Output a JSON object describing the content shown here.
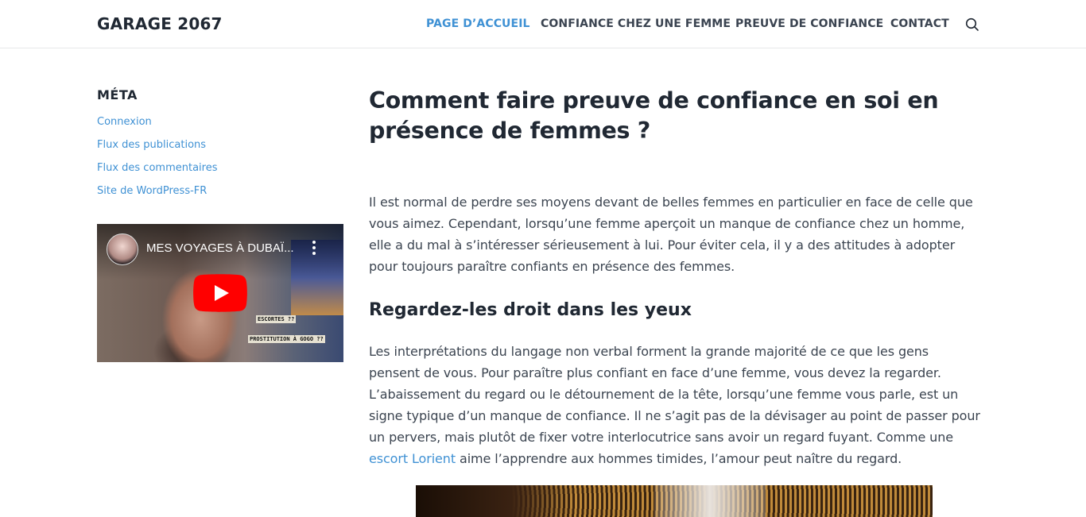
{
  "header": {
    "site_title": "GARAGE 2067",
    "nav": [
      {
        "label": "PAGE D’ACCUEIL",
        "active": true
      },
      {
        "label": "CONFIANCE CHEZ UNE FEMME",
        "active": false
      },
      {
        "label": "PREUVE DE CONFIANCE",
        "active": false
      },
      {
        "label": "CONTACT",
        "active": false
      }
    ],
    "search_icon": "search-icon"
  },
  "sidebar": {
    "meta_title": "MÉTA",
    "meta_links": [
      "Connexion",
      "Flux des publications",
      "Flux des commentaires",
      "Site de WordPress-FR"
    ],
    "video": {
      "title": "MES VOYAGES À DUBAÏ...",
      "tag1": "ESCORTES ??",
      "tag2": "PROSTITUTION À GOGO ??"
    }
  },
  "main": {
    "title": "Comment faire preuve de confiance en soi en présence de femmes ?",
    "intro": "Il est normal de perdre ses moyens devant de belles femmes en particulier en face de celle que vous aimez. Cependant, lorsqu’une femme aperçoit un manque de confiance chez un homme, elle a du mal à s’intéresser sérieusement à lui. Pour éviter cela, il y a des attitudes à adopter pour toujours paraître confiants en présence des femmes.",
    "section_heading": "Regardez-les droit dans les yeux",
    "body_before_link": "Les interprétations du langage non verbal forment la grande majorité de ce que les gens pensent de vous. Pour paraître plus confiant en face d’une femme, vous devez la regarder. L’abaissement du regard ou le détournement de la tête, lorsqu’une femme vous parle, est un signe typique d’un manque de confiance. Il ne s’agit pas de la dévisager au point de passer pour un pervers, mais plutôt de fixer votre interlocutrice sans avoir un regard fuyant. Comme une ",
    "link_text": "escort Lorient",
    "body_after_link": " aime l’apprendre aux hommes timides, l’amour peut naître du regard."
  },
  "colors": {
    "accent": "#3f91d4",
    "heading": "#202833",
    "text": "#3b4450"
  }
}
